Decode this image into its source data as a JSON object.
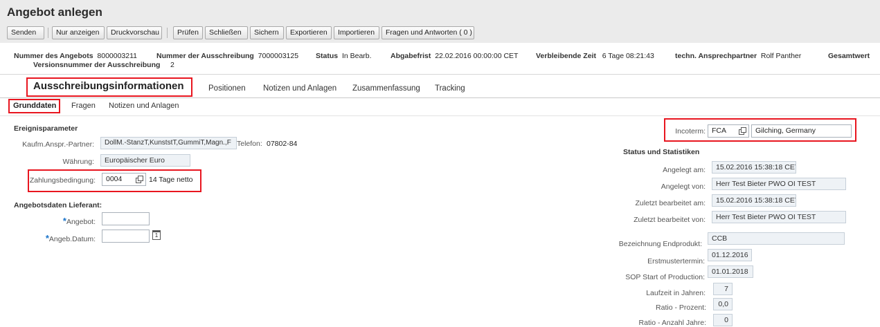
{
  "window": {
    "title": "Angebot anlegen"
  },
  "toolbar": {
    "buttons": [
      "Senden",
      "Nur anzeigen",
      "Druckvorschau",
      "Prüfen",
      "Schließen",
      "Sichern",
      "Exportieren",
      "Importieren",
      "Fragen und Antworten ( 0 )"
    ]
  },
  "header": {
    "angebot_label": "Nummer des Angebots",
    "angebot_value": "8000003211",
    "ausschreibung_label": "Nummer der Ausschreibung",
    "ausschreibung_value": "7000003125",
    "status_label": "Status",
    "status_value": "In Bearb.",
    "abgabefrist_label": "Abgabefrist",
    "abgabefrist_value": "22.02.2016 00:00:00 CET",
    "verbleibend_label": "Verbleibende Zeit",
    "verbleibend_value": "6 Tage 08:21:43",
    "ansprech_label": "techn. Ansprechpartner",
    "ansprech_value": "Rolf Panther",
    "gesamtwert_label": "Gesamtwert",
    "version_label": "Versionsnummer der Ausschreibung",
    "version_value": "2"
  },
  "tabs": [
    "Ausschreibungsinformationen",
    "Positionen",
    "Notizen und Anlagen",
    "Zusammenfassung",
    "Tracking"
  ],
  "subtabs": [
    "Grunddaten",
    "Fragen",
    "Notizen und Anlagen"
  ],
  "ereignis": {
    "title": "Ereignisparameter",
    "partner_label": "Kaufm.Anspr.-Partner:",
    "partner_value": "DollM.-StanzT,KunststT,GummiT,Magn.,F",
    "telefon_label": "Telefon:",
    "telefon_value": "07802-84",
    "waehrung_label": "Währung:",
    "waehrung_value": "Europäischer Euro",
    "zahlung_label": "Zahlungsbedingung:",
    "zahlung_code": "0004",
    "zahlung_text": "14 Tage netto"
  },
  "lieferant": {
    "title": "Angebotsdaten Lieferant:",
    "angebot_label": "Angebot:",
    "angebot_value": "",
    "datum_label": "Angeb.Datum:",
    "datum_value": "",
    "calendar_day": "1"
  },
  "incoterm": {
    "label": "Incoterm:",
    "code": "FCA",
    "location": "Gilching, Germany"
  },
  "status": {
    "title": "Status und Statistiken",
    "rows": [
      {
        "label": "Angelegt am:",
        "value": "15.02.2016 15:38:18 CET"
      },
      {
        "label": "Angelegt von:",
        "value": "Herr Test Bieter PWO OI TEST"
      },
      {
        "label": "Zuletzt bearbeitet am:",
        "value": "15.02.2016 15:38:18 CET"
      },
      {
        "label": "Zuletzt bearbeitet von:",
        "value": "Herr Test Bieter PWO OI TEST"
      }
    ],
    "endprodukt_label": "Bezeichnung Endprodukt:",
    "endprodukt_value": "CCB",
    "erstmuster_label": "Erstmustertermin:",
    "erstmuster_value": "01.12.2016",
    "sop_label": "SOP Start of Production:",
    "sop_value": "01.01.2018",
    "laufzeit_label": "Laufzeit in Jahren:",
    "laufzeit_value": "7",
    "ratio_prozent_label": "Ratio - Prozent:",
    "ratio_prozent_value": "0,0",
    "ratio_jahre_label": "Ratio - Anzahl Jahre:",
    "ratio_jahre_value": "0"
  },
  "colors": {
    "highlight": "#e8151f",
    "required": "#1a73c9",
    "readonly_bg": "#eef2f6"
  }
}
